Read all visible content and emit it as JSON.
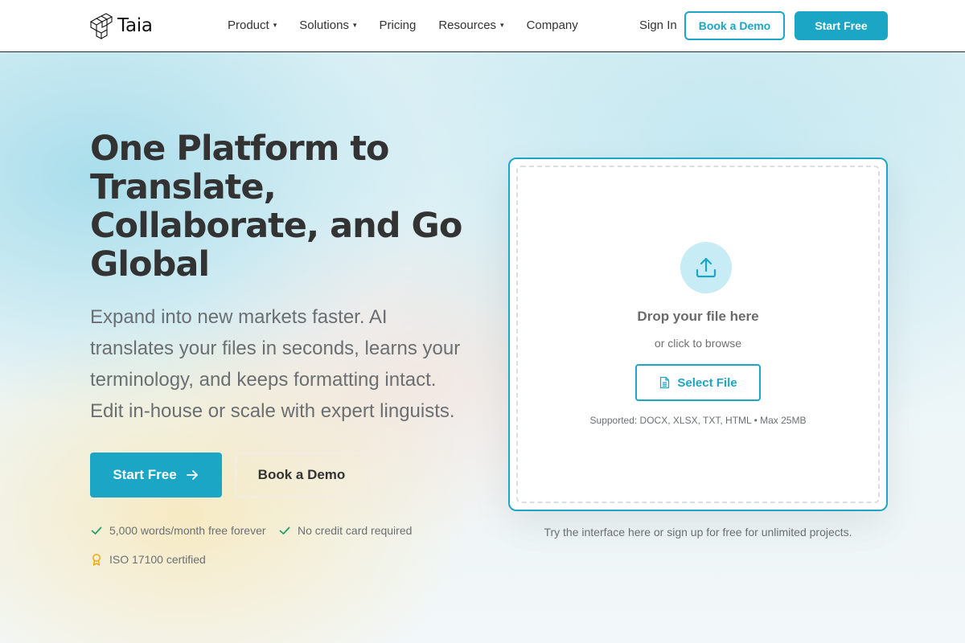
{
  "brand": {
    "name": "Taia"
  },
  "nav": {
    "items": [
      {
        "label": "Product",
        "has_dropdown": true
      },
      {
        "label": "Solutions",
        "has_dropdown": true
      },
      {
        "label": "Pricing",
        "has_dropdown": false
      },
      {
        "label": "Resources",
        "has_dropdown": true
      },
      {
        "label": "Company",
        "has_dropdown": false
      }
    ],
    "caret_glyph": "▾",
    "sign_in": "Sign In",
    "book_demo": "Book a Demo",
    "start_free": "Start Free"
  },
  "hero": {
    "title": "One Platform to Translate, Collaborate, and Go Global",
    "subtitle": "Expand into new markets faster. AI translates your files in seconds, learns your terminology, and keeps formatting intact. Edit in-house or scale with expert linguists.",
    "start_free": "Start Free",
    "book_demo": "Book a Demo",
    "features": [
      {
        "icon": "check-icon",
        "text": "5,000 words/month free forever"
      },
      {
        "icon": "check-icon",
        "text": "No credit card required"
      },
      {
        "icon": "award-icon",
        "text": "ISO 17100 certified"
      }
    ]
  },
  "upload": {
    "title": "Drop your file here",
    "subtitle": "or click to browse",
    "select_button": "Select File",
    "supported": "Supported: DOCX, XLSX, TXT, HTML • Max 25MB",
    "note": "Try the interface here or sign up for free for unlimited projects."
  },
  "colors": {
    "accent": "#1ba6c6",
    "check": "#22a06b",
    "award": "#f0a500",
    "heading": "#333333",
    "muted": "#6b6f72"
  }
}
